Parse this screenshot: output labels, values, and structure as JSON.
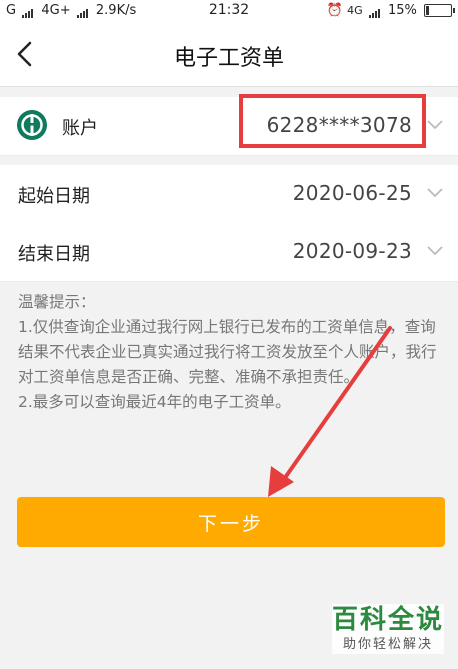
{
  "status_bar": {
    "carrier": "G",
    "network": "4G+",
    "speed": "2.9K/s",
    "time": "21:32",
    "network_right": "4G",
    "battery": "15%",
    "battery_level": 0.15
  },
  "header": {
    "title": "电子工资单"
  },
  "form": {
    "account": {
      "label": "账户",
      "value": "6228****3078"
    },
    "start_date": {
      "label": "起始日期",
      "value": "2020-06-25"
    },
    "end_date": {
      "label": "结束日期",
      "value": "2020-09-23"
    }
  },
  "tips": {
    "title": "温馨提示：",
    "line1": "1.仅供查询企业通过我行网上银行已发布的工资单信息，查询结果不代表企业已真实通过我行将工资发放至个人账户，我行对工资单信息是否正确、完整、准确不承担责任。",
    "line2": "2.最多可以查询最近4年的电子工资单。"
  },
  "buttons": {
    "next": "下一步"
  },
  "watermark": {
    "title": "百科全说",
    "subtitle": "助你轻松解决"
  },
  "colors": {
    "accent": "#ffaa00",
    "highlight": "#e63d3d",
    "bank_green": "#0f7a5c"
  }
}
